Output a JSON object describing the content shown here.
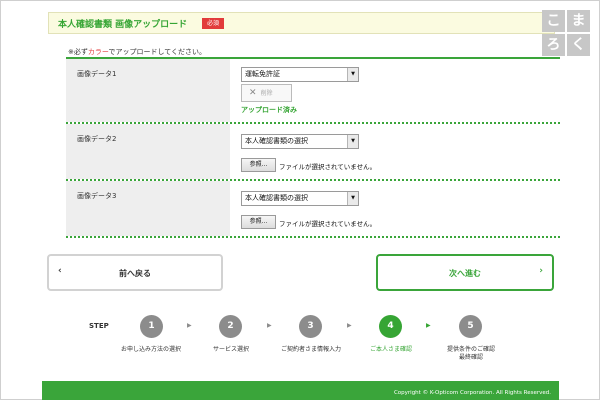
{
  "header": {
    "title": "本人確認書類 画像アップロード",
    "required_badge": "必須"
  },
  "note": {
    "prefix": "※必ず",
    "highlight": "カラー",
    "suffix": "でアップロードしてください。"
  },
  "rows": [
    {
      "label": "画像データ1",
      "select_value": "運転免許証",
      "delete_label": "削除",
      "status": "アップロード済み"
    },
    {
      "label": "画像データ2",
      "select_value": "本人確認書類の選択",
      "browse_label": "参照...",
      "file_status": "ファイルが選択されていません。"
    },
    {
      "label": "画像データ3",
      "select_value": "本人確認書類の選択",
      "browse_label": "参照...",
      "file_status": "ファイルが選択されていません。"
    }
  ],
  "nav": {
    "back_label": "前へ戻る",
    "next_label": "次へ進む"
  },
  "steps": {
    "label": "STEP",
    "current": 4,
    "items": [
      {
        "number": "1",
        "name": "お申し込み方法の選択"
      },
      {
        "number": "2",
        "name": "サービス選択"
      },
      {
        "number": "3",
        "name": "ご契約者さま情報入力"
      },
      {
        "number": "4",
        "name": "ご本人さま確認"
      },
      {
        "number": "5",
        "name_line1": "提供条件のご確認",
        "name_line2": "最終確認"
      }
    ]
  },
  "footer": {
    "copyright": "Copyright © K-Opticom Corporation. All Rights Reserved."
  },
  "logo": {
    "chars": [
      "こ",
      "ま",
      "ろ",
      "く"
    ]
  },
  "colors": {
    "accent_green": "#36a534",
    "required_red": "#e23b3b",
    "step_inactive": "#8c8c8c"
  },
  "icons": {
    "select_arrow": "caret-down-icon",
    "delete": "close-icon",
    "back": "chevron-left-icon",
    "next": "chevron-right-icon",
    "step_sep": "triangle-right-icon"
  }
}
